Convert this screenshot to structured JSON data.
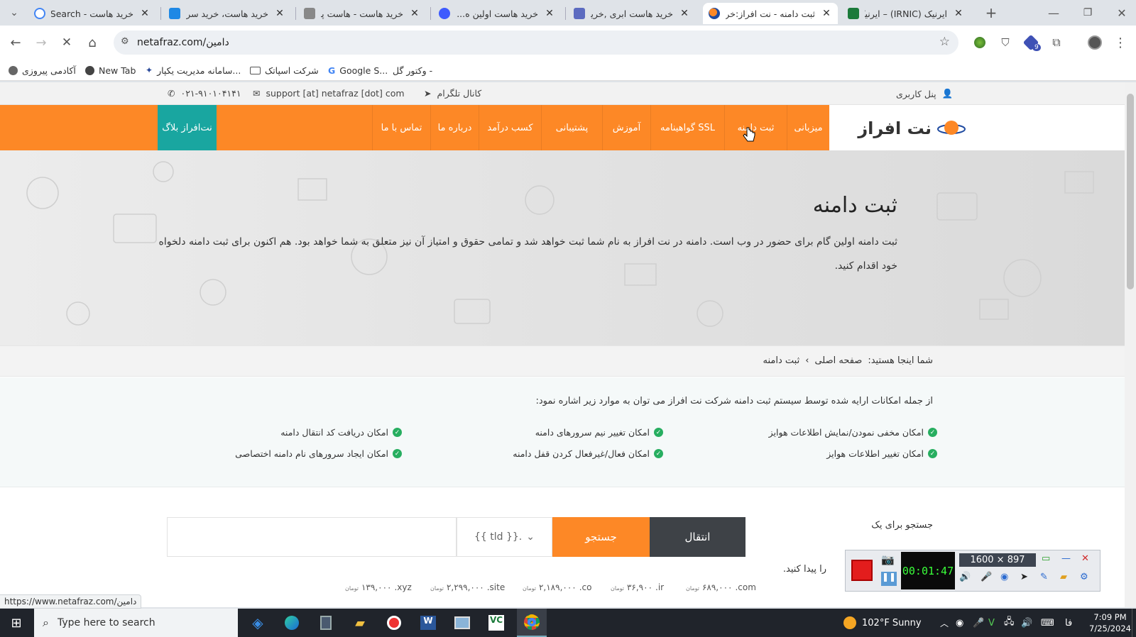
{
  "browser": {
    "tabs": [
      {
        "label": "خرید هاست - Search",
        "favicon": "google-icon",
        "active": false
      },
      {
        "label": "خرید هاست، خرید سرور",
        "favicon": "site-icon",
        "active": false
      },
      {
        "label": "خرید هاست - هاست پر...",
        "favicon": "site-icon",
        "active": false
      },
      {
        "label": "خرید هاست اولین ه...",
        "favicon": "site-icon",
        "active": false
      },
      {
        "label": "خرید هاست ابری ,خرید",
        "favicon": "site-icon",
        "active": false
      },
      {
        "label": "ثبت دامنه - نت افراز:خر...",
        "favicon": "netafraz-icon",
        "active": true
      },
      {
        "label": "ایرنیک (IRNIC) – ایرنیک",
        "favicon": "irnic-icon",
        "active": false
      }
    ],
    "url": "netafraz.com/دامین",
    "bookmarks": [
      "آکادمی پیروزی",
      "New Tab",
      "سامانه مدیریت یکپار...",
      "شرکت اسپاتک",
      "Google S...",
      "وکتور گل -"
    ],
    "status_url": "https://www.netafraz.com/دامین",
    "extension_badge": "9"
  },
  "site": {
    "topbar": {
      "user_panel": "پنل کاربری",
      "telegram": "کانال تلگرام",
      "email": "support [at] netafraz [dot] com",
      "phone": "۰۲۱-۹۱۰۱۰۴۱۴۱"
    },
    "logo_text": "نت افراز",
    "nav": [
      "میزبانی",
      "ثبت دامنه",
      "گواهینامه SSL",
      "آموزش",
      "پشتیبانی",
      "کسب درآمد",
      "درباره ما",
      "تماس با ما"
    ],
    "blog_button": "نت‌افراز بلاگ",
    "hero": {
      "title": "ثبت دامنه",
      "text": "ثبت دامنه اولین گام برای حضور در وب است. دامنه در نت افراز به نام شما ثبت خواهد شد و تمامی حقوق و امتیاز آن نیز متعلق به شما خواهد بود. هم اکنون برای ثبت دامنه دلخواه خود اقدام کنید."
    },
    "breadcrumb": {
      "prefix": "شما اینجا هستید:",
      "home": "صفحه اصلی",
      "current": "ثبت دامنه"
    },
    "features": {
      "intro": "از جمله امکانات ارایه شده توسط سیستم ثبت دامنه شرکت نت افراز می توان به موارد زیر اشاره نمود:",
      "items": [
        "امکان مخفی نمودن/نمایش اطلاعات هوایز",
        "امکان تغییر نیم سرورهای دامنه",
        "امکان دریافت کد انتقال دامنه",
        "امکان تغییر اطلاعات هوایز",
        "امکان فعال/غیرفعال کردن قفل دامنه",
        "امکان ایجاد سرورهای نام دامنه اختصاصی"
      ]
    },
    "search": {
      "label_top": "جستجو برای یک",
      "label_bottom": "را پیدا کنید.",
      "tld_select": "{{ tld }}.",
      "search_button": "جستجو",
      "transfer_button": "انتقال",
      "prices": [
        {
          "tld": ".com",
          "price": "۶۸۹,۰۰۰",
          "unit": "تومان"
        },
        {
          "tld": ".ir",
          "price": "۳۶,۹۰۰",
          "unit": "تومان"
        },
        {
          "tld": ".co",
          "price": "۲,۱۸۹,۰۰۰",
          "unit": "تومان"
        },
        {
          "tld": ".site",
          "price": "۲,۲۹۹,۰۰۰",
          "unit": "تومان"
        },
        {
          "tld": ".xyz",
          "price": "۱۳۹,۰۰۰",
          "unit": "تومان"
        }
      ]
    }
  },
  "recorder": {
    "time": "00:01:47",
    "resolution": "1600 × 897"
  },
  "taskbar": {
    "search_placeholder": "Type here to search",
    "weather": "102°F  Sunny",
    "lang": "فا",
    "time": "7:09 PM",
    "date": "7/25/2024"
  },
  "colors": {
    "orange": "#fd8826",
    "teal": "#19a6a0",
    "dark": "#3e4247",
    "check": "#27ae60"
  }
}
